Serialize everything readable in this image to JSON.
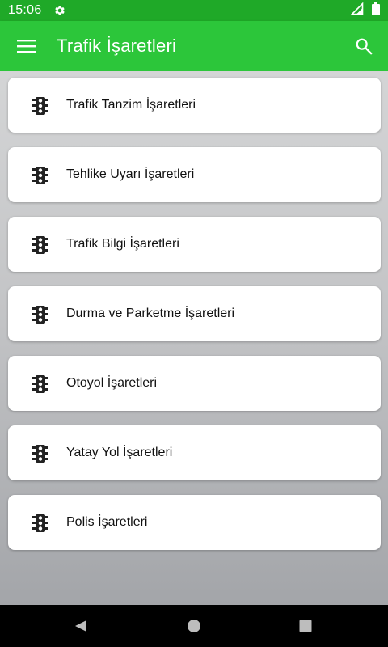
{
  "status_bar": {
    "time": "15:06",
    "icons": [
      "settings-gear-icon",
      "signal-icon",
      "battery-icon"
    ]
  },
  "app_bar": {
    "title": "Trafik İşaretleri",
    "icons": [
      "hamburger-menu-icon",
      "search-icon"
    ]
  },
  "categories": [
    {
      "label": "Trafik Tanzim İşaretleri",
      "icon": "traffic-light-icon"
    },
    {
      "label": "Tehlike Uyarı İşaretleri",
      "icon": "traffic-light-icon"
    },
    {
      "label": "Trafik Bilgi İşaretleri",
      "icon": "traffic-light-icon"
    },
    {
      "label": "Durma ve Parketme İşaretleri",
      "icon": "traffic-light-icon"
    },
    {
      "label": "Otoyol İşaretleri",
      "icon": "traffic-light-icon"
    },
    {
      "label": "Yatay Yol İşaretleri",
      "icon": "traffic-light-icon"
    },
    {
      "label": "Polis İşaretleri",
      "icon": "traffic-light-icon"
    }
  ],
  "nav_bar": {
    "icons": [
      "back-icon",
      "home-icon",
      "recents-icon"
    ]
  },
  "colors": {
    "status_bar": "#1fa928",
    "app_bar": "#2cc63a",
    "card_background": "#ffffff",
    "icon": "#222222",
    "nav_bar": "#000000"
  }
}
